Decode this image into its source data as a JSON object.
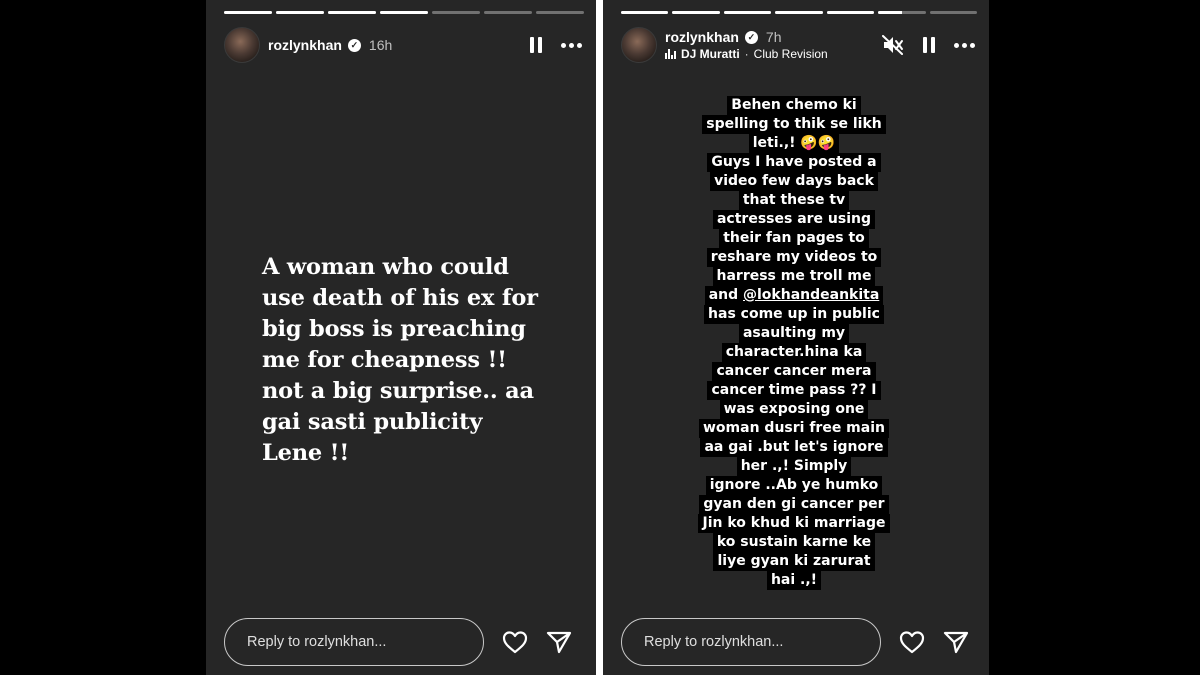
{
  "left_story": {
    "username": "rozlynkhan",
    "time": "16h",
    "progress": [
      1,
      1,
      1,
      1,
      0,
      0,
      0
    ],
    "text_lines": [
      "A woman who could",
      "use death of his ex for",
      "big boss is preaching",
      "me for cheapness !!",
      "not a big surprise.. aa",
      "gai sasti publicity",
      "Lene !!"
    ],
    "reply_placeholder": "Reply to rozlynkhan..."
  },
  "right_story": {
    "username": "rozlynkhan",
    "time": "7h",
    "music_artist": "DJ Muratti",
    "music_separator": "·",
    "music_track": "Club Revision",
    "progress": [
      1,
      1,
      1,
      1,
      1,
      0.5,
      0
    ],
    "text_lines": [
      "Behen chemo ki",
      "spelling to thik se likh",
      "leti.,! 🤪🤪",
      "Guys I have posted a",
      "video few days back",
      "that these tv",
      "actresses are using",
      "their fan pages to",
      "reshare my videos to",
      "harress me troll me",
      "and @lokhandeankita",
      "has come up in public",
      "asaulting my",
      "character.hina ka",
      "cancer cancer mera",
      "cancer time pass ?? I",
      "was exposing one",
      "woman dusri free main",
      "aa gai .but let's ignore",
      "her .,!  Simply",
      "ignore ..Ab ye humko",
      "gyan den gi cancer per",
      "Jin ko khud ki marriage",
      "ko sustain karne ke",
      "liye gyan ki zarurat",
      "hai .,!"
    ],
    "mention": "@lokhandeankita",
    "reply_placeholder": "Reply to rozlynkhan..."
  },
  "icons": {
    "verified": "verified-badge-icon",
    "pause": "pause-icon",
    "more": "more-options-icon",
    "mute": "muted-speaker-icon",
    "heart": "heart-icon",
    "send": "send-icon",
    "music": "music-bars-icon"
  },
  "colors": {
    "story_bg": "#262626",
    "text": "#ffffff",
    "text_highlight_bg": "#000000"
  }
}
